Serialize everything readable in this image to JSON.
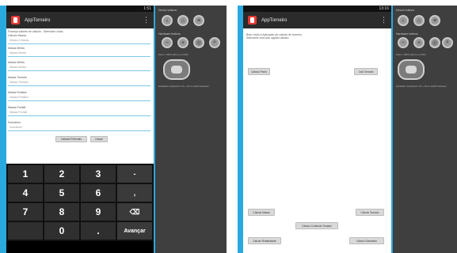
{
  "left": {
    "status": "1:51",
    "app_title": "AppTorneiro",
    "intro": "Forneça valores de cálculo - Selecione coisa",
    "fields": [
      {
        "label": "Cálculo Massa",
        "placeholder": "Massa e Massa"
      },
      {
        "label": "Massa Média",
        "placeholder": "Massa Média"
      },
      {
        "label": "Massa Média",
        "placeholder": "Massa Média"
      },
      {
        "label": "Massa Tornado",
        "placeholder": "Massa Tornado"
      },
      {
        "label": "Massa Rotativo",
        "placeholder": "Massa Rotativo"
      },
      {
        "label": "Massa Portátil",
        "placeholder": "Massa Portátil"
      },
      {
        "label": "Somatório",
        "placeholder": "Somatório"
      }
    ],
    "buttons": {
      "primary": "Calcular Fórmulas",
      "secondary": "Limpar"
    },
    "keys": [
      "1",
      "2",
      "3",
      "-",
      "4",
      "5",
      "6",
      ",",
      "7",
      "8",
      "9",
      "⌫",
      "",
      "0",
      ".",
      "Avançar"
    ]
  },
  "right": {
    "status": "13:16",
    "app_title": "AppTorneiro",
    "intro_1": "Bem vindo à Aplicação de cálculo de torneiro.",
    "intro_2": "Selecione uma das opções abaixo:",
    "buttons": [
      "Cálculo Ponto",
      "Calc Tornado",
      "Cálculo Massa",
      "Cálculo Tornado",
      "Cálculo Conteúdo Tornado",
      "Cálculo Rotatividade",
      "Cálculo Somatório"
    ]
  },
  "controls_left": {
    "title1": "Device buttons",
    "title2": "Hardware buttons",
    "zoom": "Zoom: 100% (Zoom on DPI)",
    "note": "Hardware Keyboard: ctrl + F4 to switch between"
  },
  "controls_right": {
    "title1": "Device buttons",
    "title2": "Hardware buttons",
    "zoom": "Zoom: 100% (Zoom on DPI)",
    "note": "Hardware Keyboard: ctrl + F4 to switch between"
  }
}
